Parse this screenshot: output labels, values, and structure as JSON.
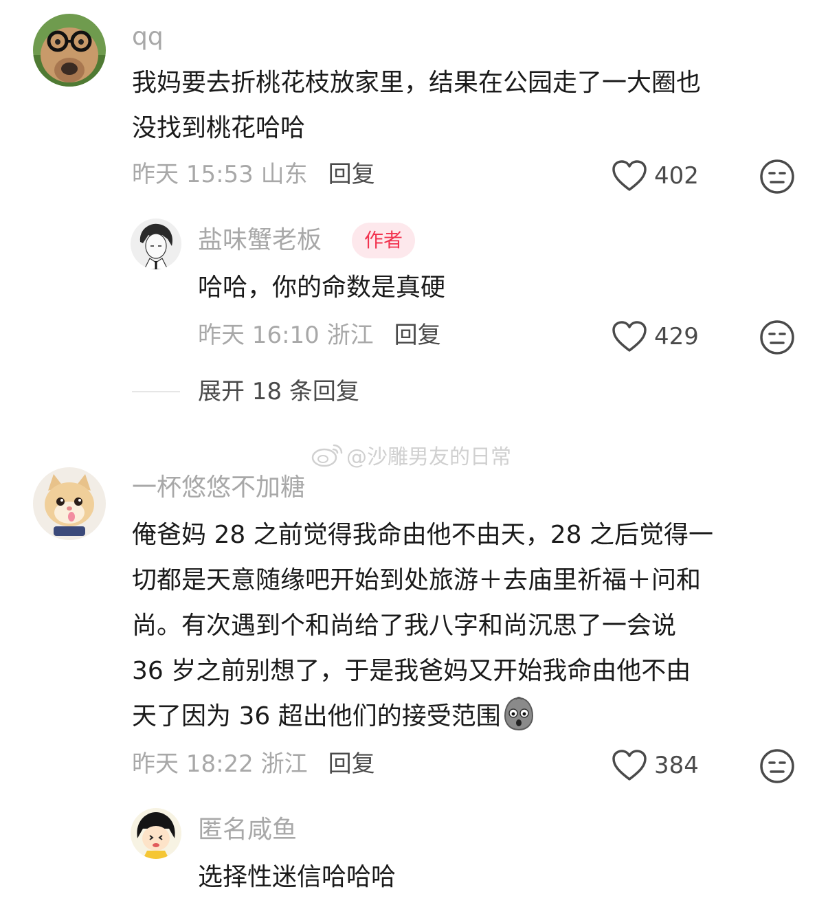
{
  "comments": [
    {
      "username": "qq",
      "text_lines": [
        "我妈要去折桃花枝放家里，结果在公园走了一大圈也",
        "没找到桃花哈哈"
      ],
      "time": "昨天 15:53 山东",
      "reply_label": "回复",
      "likes": "402",
      "avatar_icon": "dog-with-glasses-avatar",
      "replies": [
        {
          "username": "盐味蟹老板",
          "badge": "作者",
          "text": "哈哈，你的命数是真硬",
          "time": "昨天 16:10 浙江",
          "reply_label": "回复",
          "likes": "429",
          "avatar_icon": "anime-boy-avatar"
        }
      ],
      "expand_label": "展开 18 条回复"
    },
    {
      "username": "一杯悠悠不加糖",
      "text_lines": [
        "俺爸妈 28 之前觉得我命由他不由天，28 之后觉得一",
        "切都是天意随缘吧开始到处旅游＋去庙里祈福＋问和",
        "尚。有次遇到个和尚给了我八字和尚沉思了一会说",
        " 36 岁之前别想了，于是我爸妈又开始我命由他不由",
        "天了因为 36 超出他们的接受范围"
      ],
      "time": "昨天 18:22 浙江",
      "reply_label": "回复",
      "likes": "384",
      "avatar_icon": "cat-avatar",
      "inline_emoji": "shocked-face-emoji",
      "replies": [
        {
          "username": "匿名咸鱼",
          "text": "选择性迷信哈哈哈",
          "avatar_icon": "cartoon-girl-avatar"
        }
      ]
    }
  ],
  "watermark": "@沙雕男友的日常",
  "colors": {
    "muted_text": "#a8a8a8",
    "body_text": "#1a1a1a",
    "badge_text": "#f2334f",
    "badge_bg": "#fde8ec"
  }
}
